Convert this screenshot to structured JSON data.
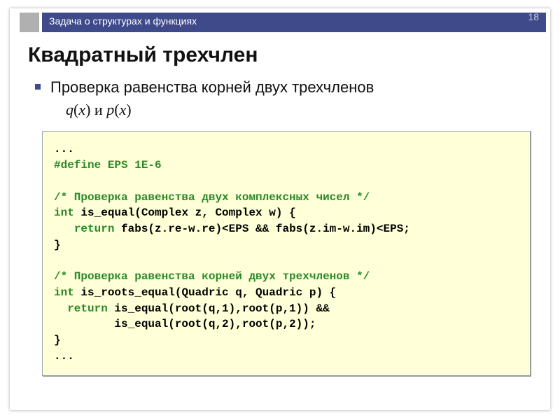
{
  "meta": {
    "topbar_title": "Задача о структурах и функциях",
    "page_number": "18"
  },
  "heading": "Квадратный трехчлен",
  "bullet": {
    "text": "Проверка равенства корней двух трехчленов",
    "math_q": "q",
    "math_p": "p",
    "math_var": "x",
    "math_and": " и "
  },
  "code": {
    "l01": "...",
    "l02_pre": "#define EPS 1E-6",
    "l03": "",
    "l04_cmt": "/* Проверка равенства двух комплексных чисел */",
    "l05_kw": "int",
    "l05_rest": " is_equal(Complex z, Complex w) {",
    "l06_indent": "   ",
    "l06_kw": "return",
    "l06_rest": " fabs(z.re-w.re)<EPS && fabs(z.im-w.im)<EPS;",
    "l07": "}",
    "l08": "",
    "l09_cmt": "/* Проверка равенства корней двух трехчленов */",
    "l10_kw": "int",
    "l10_rest": " is_roots_equal(Quadric q, Quadric p) {",
    "l11_indent": "  ",
    "l11_kw": "return",
    "l11_rest": " is_equal(root(q,1),root(p,1)) &&",
    "l12": "         is_equal(root(q,2),root(p,2));",
    "l13": "}",
    "l14": "..."
  }
}
